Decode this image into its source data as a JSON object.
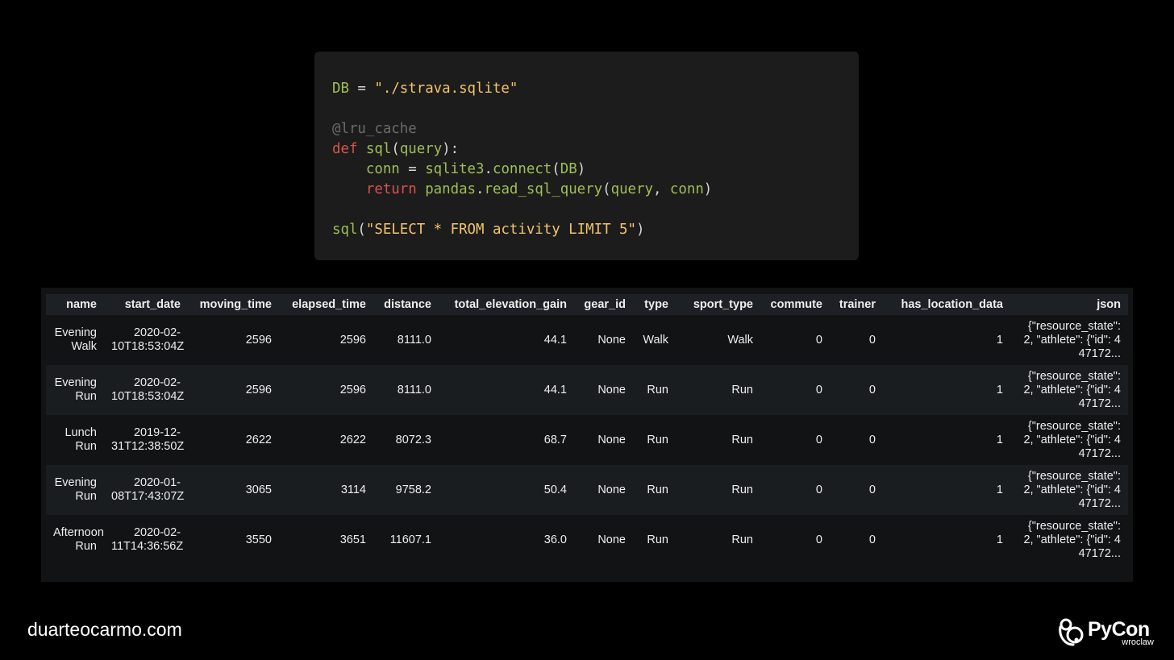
{
  "code": {
    "lines": [
      [
        {
          "t": "DB",
          "c": "var"
        },
        {
          "t": " = ",
          "c": "op"
        },
        {
          "t": "\"./strava.sqlite\"",
          "c": "str"
        }
      ],
      [],
      [
        {
          "t": "@lru_cache",
          "c": "deco"
        }
      ],
      [
        {
          "t": "def",
          "c": "kw"
        },
        {
          "t": " ",
          "c": "op"
        },
        {
          "t": "sql",
          "c": "var"
        },
        {
          "t": "(",
          "c": "punct"
        },
        {
          "t": "query",
          "c": "var"
        },
        {
          "t": "):",
          "c": "punct"
        }
      ],
      [
        {
          "t": "    ",
          "c": "op"
        },
        {
          "t": "conn",
          "c": "var"
        },
        {
          "t": " = ",
          "c": "op"
        },
        {
          "t": "sqlite3",
          "c": "var"
        },
        {
          "t": ".",
          "c": "punct"
        },
        {
          "t": "connect",
          "c": "var"
        },
        {
          "t": "(",
          "c": "punct"
        },
        {
          "t": "DB",
          "c": "var"
        },
        {
          "t": ")",
          "c": "punct"
        }
      ],
      [
        {
          "t": "    ",
          "c": "op"
        },
        {
          "t": "return",
          "c": "kw"
        },
        {
          "t": " ",
          "c": "op"
        },
        {
          "t": "pandas",
          "c": "var"
        },
        {
          "t": ".",
          "c": "punct"
        },
        {
          "t": "read_sql_query",
          "c": "var"
        },
        {
          "t": "(",
          "c": "punct"
        },
        {
          "t": "query",
          "c": "var"
        },
        {
          "t": ", ",
          "c": "punct"
        },
        {
          "t": "conn",
          "c": "var"
        },
        {
          "t": ")",
          "c": "punct"
        }
      ],
      [],
      [
        {
          "t": "sql",
          "c": "var"
        },
        {
          "t": "(",
          "c": "punct"
        },
        {
          "t": "\"SELECT * FROM activity LIMIT 5\"",
          "c": "str"
        },
        {
          "t": ")",
          "c": "punct"
        }
      ]
    ]
  },
  "table": {
    "columns": [
      "name",
      "start_date",
      "moving_time",
      "elapsed_time",
      "distance",
      "total_elevation_gain",
      "gear_id",
      "type",
      "sport_type",
      "commute",
      "trainer",
      "has_location_data",
      "json"
    ],
    "rows": [
      [
        "Evening Walk",
        "2020-02-10T18:53:04Z",
        "2596",
        "2596",
        "8111.0",
        "44.1",
        "None",
        "Walk",
        "Walk",
        "0",
        "0",
        "1",
        "{\"resource_state\": 2, \"athlete\": {\"id\": 447172..."
      ],
      [
        "Evening Run",
        "2020-02-10T18:53:04Z",
        "2596",
        "2596",
        "8111.0",
        "44.1",
        "None",
        "Run",
        "Run",
        "0",
        "0",
        "1",
        "{\"resource_state\": 2, \"athlete\": {\"id\": 447172..."
      ],
      [
        "Lunch Run",
        "2019-12-31T12:38:50Z",
        "2622",
        "2622",
        "8072.3",
        "68.7",
        "None",
        "Run",
        "Run",
        "0",
        "0",
        "1",
        "{\"resource_state\": 2, \"athlete\": {\"id\": 447172..."
      ],
      [
        "Evening Run",
        "2020-01-08T17:43:07Z",
        "3065",
        "3114",
        "9758.2",
        "50.4",
        "None",
        "Run",
        "Run",
        "0",
        "0",
        "1",
        "{\"resource_state\": 2, \"athlete\": {\"id\": 447172..."
      ],
      [
        "Afternoon Run",
        "2020-02-11T14:36:56Z",
        "3550",
        "3651",
        "11607.1",
        "36.0",
        "None",
        "Run",
        "Run",
        "0",
        "0",
        "1",
        "{\"resource_state\": 2, \"athlete\": {\"id\": 447172..."
      ]
    ]
  },
  "footer": {
    "url": "duarteocarmo.com",
    "logo_text": "PyCon",
    "logo_subtext": "wroclaw"
  },
  "colors": {
    "background": "#000000",
    "code_bg": "#1c1c1c",
    "table_bg": "#111315",
    "table_header_bg": "#1d2024",
    "table_alt_row_bg": "#1a1d20",
    "code_var": "#9fbf55",
    "code_string": "#f2c46b",
    "code_keyword": "#d9534f",
    "code_decorator": "#6b6b6b"
  }
}
